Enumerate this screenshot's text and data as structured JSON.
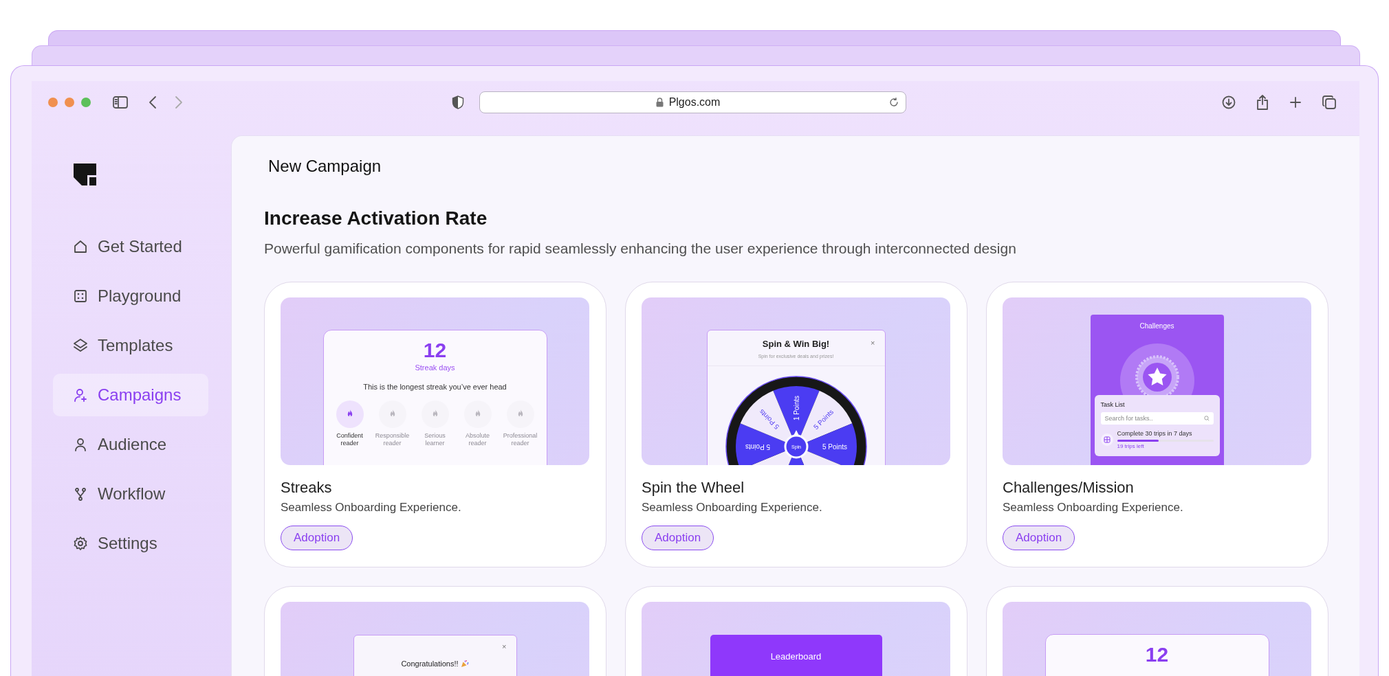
{
  "browser": {
    "url": "Plgos.com"
  },
  "sidebar": {
    "items": [
      {
        "label": "Get Started",
        "selected": false
      },
      {
        "label": "Playground",
        "selected": false
      },
      {
        "label": "Templates",
        "selected": false
      },
      {
        "label": "Campaigns",
        "selected": true
      },
      {
        "label": "Audience",
        "selected": false
      },
      {
        "label": "Workflow",
        "selected": false
      },
      {
        "label": "Settings",
        "selected": false
      }
    ]
  },
  "page": {
    "title": "New Campaign",
    "heading": "Increase Activation Rate",
    "description": "Powerful gamification components for rapid seamlessly enhancing the user experience through interconnected design"
  },
  "cards": [
    {
      "title": "Streaks",
      "subtitle": "Seamless Onboarding Experience.",
      "tag": "Adoption",
      "preview": {
        "kind": "streak",
        "count": "12",
        "caption": "Streak days",
        "message": "This is the longest streak you’ve ever head",
        "badges": [
          {
            "label": "Confident reader",
            "selected": true
          },
          {
            "label": "Responsible reader",
            "selected": false
          },
          {
            "label": "Serious learner",
            "selected": false
          },
          {
            "label": "Absolute reader",
            "selected": false
          },
          {
            "label": "Professional reader",
            "selected": false
          }
        ]
      }
    },
    {
      "title": "Spin the Wheel",
      "subtitle": "Seamless Onboarding Experience.",
      "tag": "Adoption",
      "preview": {
        "kind": "wheel",
        "title": "Spin & Win Big!",
        "subtitle": "Spin for exclusive deals and prizes!",
        "close": "×",
        "button": "Spin",
        "segments": [
          {
            "label": "1 Points",
            "color": "#4b3cf2"
          },
          {
            "label": "5 Points",
            "color": "#f0eafb"
          },
          {
            "label": "5 Points",
            "color": "#4b3cf2"
          },
          {
            "color": "#f0eafb"
          },
          {
            "color": "#4b3cf2"
          },
          {
            "color": "#f0eafb"
          },
          {
            "label": "5 Points",
            "color": "#4b3cf2"
          },
          {
            "label": "5 Points",
            "color": "#f0eafb"
          }
        ]
      }
    },
    {
      "title": "Challenges/Mission",
      "subtitle": "Seamless Onboarding Experience.",
      "tag": "Adoption",
      "preview": {
        "kind": "challenges",
        "title": "Challenges",
        "panel_title": "Task List",
        "search_placeholder": "Search for tasks..",
        "task": {
          "label": "Complete 30 trips in 7 days",
          "level": 0.43,
          "remaining": "19 trips left"
        }
      }
    },
    {
      "preview": {
        "kind": "message",
        "close": "×",
        "title": "Congratulations!!"
      }
    },
    {
      "preview": {
        "kind": "leaderboard",
        "title": "Leaderboard"
      }
    },
    {
      "preview": {
        "kind": "streak",
        "count": "12"
      }
    }
  ]
}
